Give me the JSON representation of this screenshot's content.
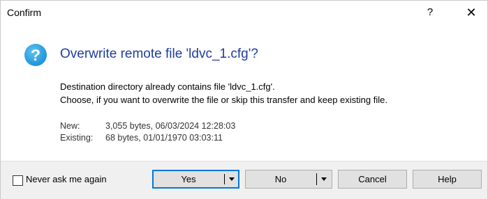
{
  "window": {
    "title": "Confirm",
    "help_glyph": "?",
    "close_glyph": "✕"
  },
  "icon": {
    "name": "question-icon",
    "glyph": "?",
    "color": "#2a9ee0"
  },
  "heading": "Overwrite remote file 'ldvc_1.cfg'?",
  "message": {
    "line1": "Destination directory already contains file 'ldvc_1.cfg'.",
    "line2": "Choose, if you want to overwrite the file or skip this transfer and keep existing file."
  },
  "details": {
    "new_label": "New:",
    "new_value": "3,055 bytes, 06/03/2024 12:28:03",
    "existing_label": "Existing:",
    "existing_value": "68 bytes, 01/01/1970 03:03:11"
  },
  "footer": {
    "never_ask_label": "Never ask me again",
    "never_ask_checked": false,
    "yes_label": "Yes",
    "no_label": "No",
    "cancel_label": "Cancel",
    "help_label": "Help"
  },
  "colors": {
    "heading": "#1f3d9c",
    "primary_border": "#0078d7",
    "footer_bg": "#f0f0f0"
  }
}
